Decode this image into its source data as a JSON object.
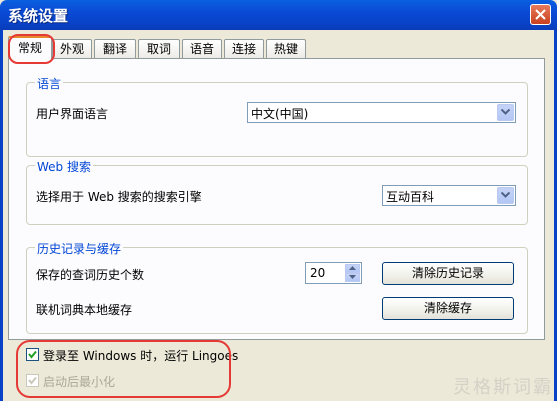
{
  "window": {
    "title": "系统设置"
  },
  "tabs": [
    {
      "label": "常规",
      "active": true
    },
    {
      "label": "外观"
    },
    {
      "label": "翻译"
    },
    {
      "label": "取词"
    },
    {
      "label": "语音"
    },
    {
      "label": "连接"
    },
    {
      "label": "热键"
    }
  ],
  "language_group": {
    "legend": "语言",
    "label": "用户界面语言",
    "selected": "中文(中国)"
  },
  "search_group": {
    "legend": "Web 搜索",
    "label": "选择用于 Web 搜索的搜索引擎",
    "selected": "互动百科"
  },
  "history_group": {
    "legend": "历史记录与缓存",
    "history_label": "保存的查词历史个数",
    "history_count": "20",
    "clear_history_button": "清除历史记录",
    "cache_label": "联机词典本地缓存",
    "clear_cache_button": "清除缓存"
  },
  "options": {
    "login_run": {
      "label": "登录至 Windows 时，运行 Lingoes",
      "checked": true,
      "enabled": true
    },
    "start_minimized": {
      "label": "启动后最小化",
      "checked": true,
      "enabled": false
    }
  },
  "watermark": "灵格斯词霸",
  "colors": {
    "accent": "#0046d5",
    "highlight": "#e53935",
    "titlebar": "#0a4ad6"
  }
}
